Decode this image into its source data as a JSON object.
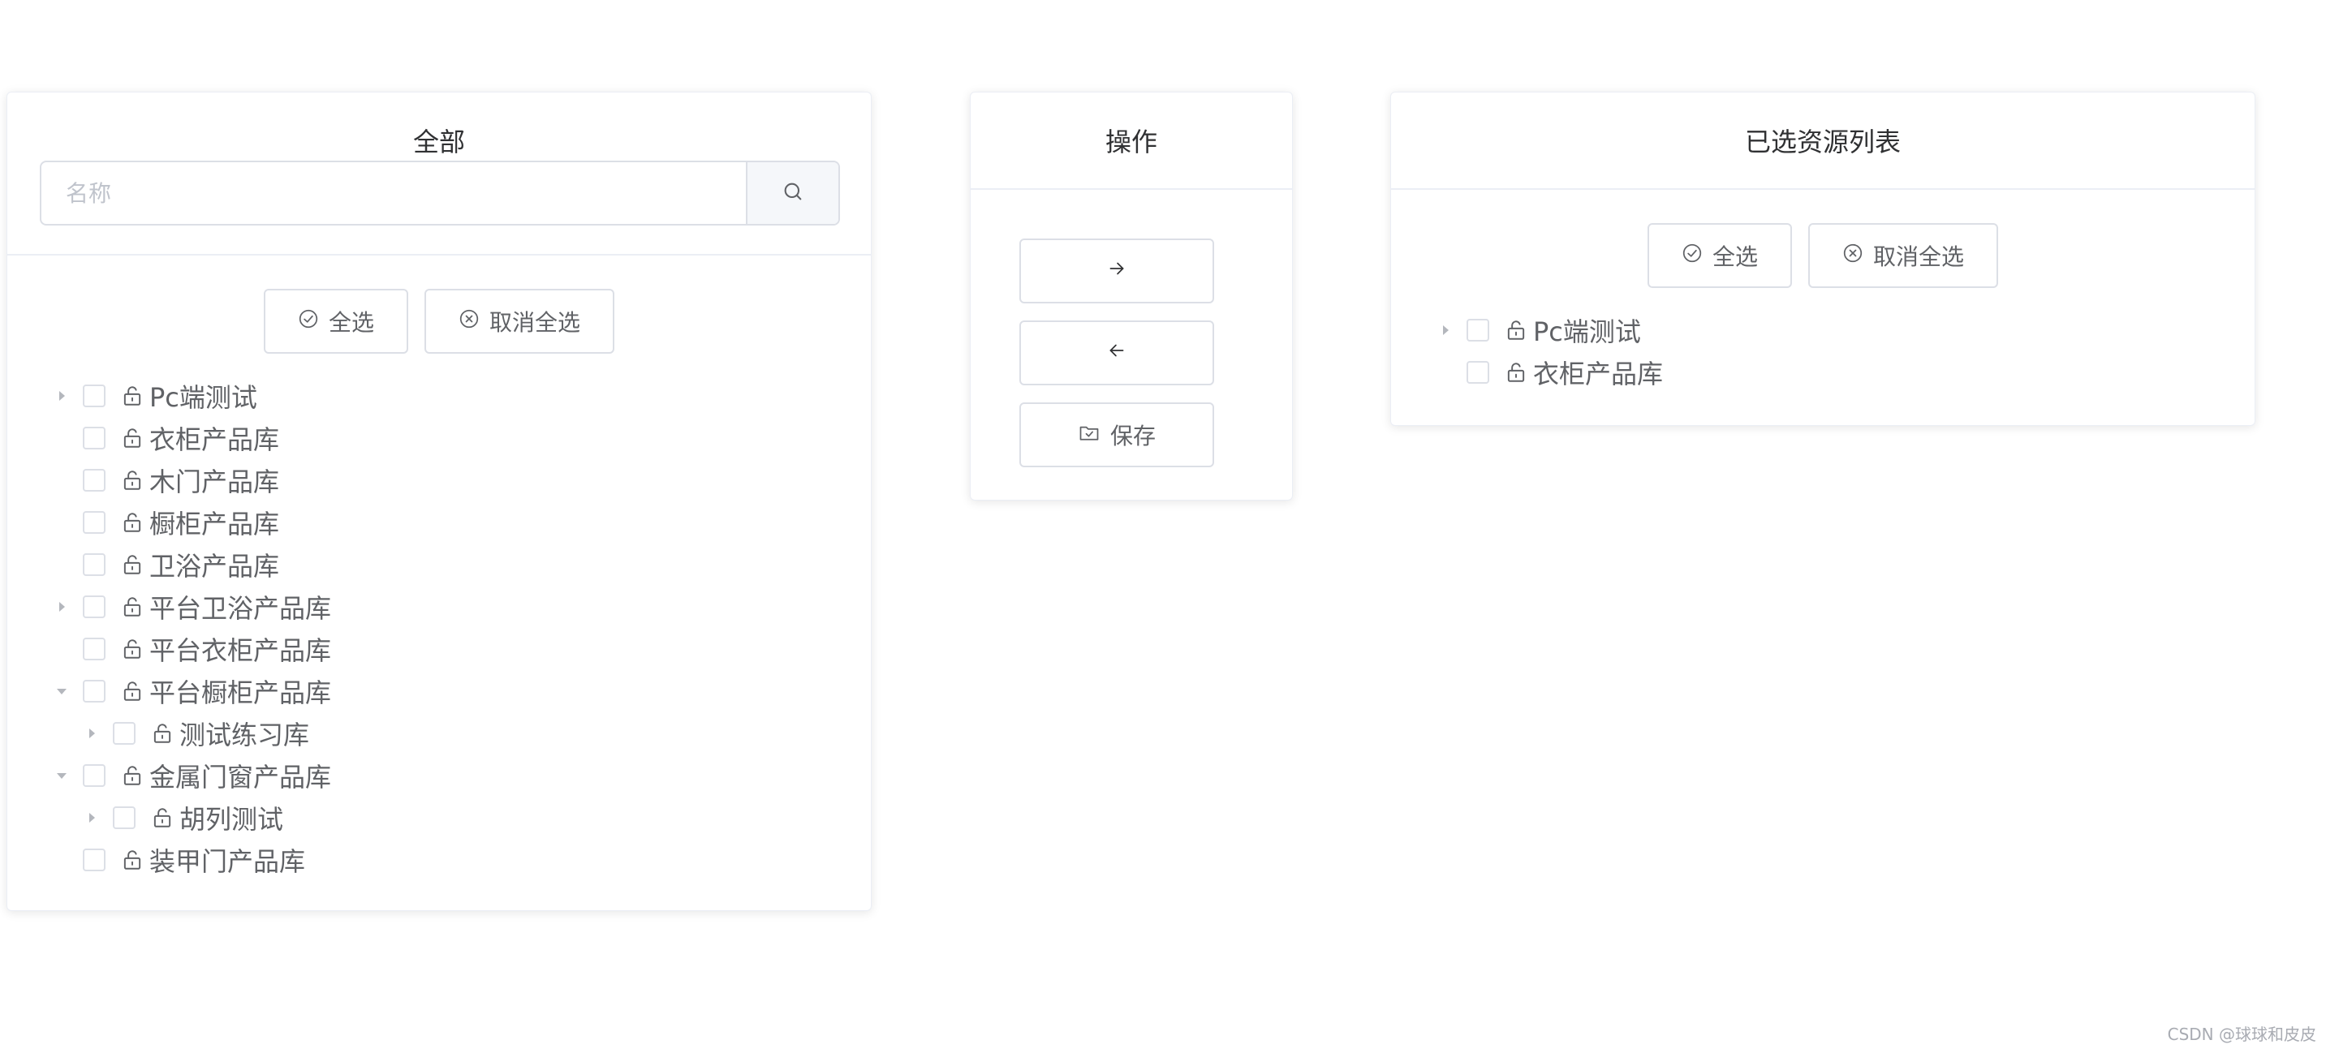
{
  "left_panel": {
    "title": "全部",
    "search": {
      "placeholder": "名称",
      "value": "",
      "icon": "search-icon"
    },
    "select_all_label": "全选",
    "deselect_all_label": "取消全选",
    "tree": [
      {
        "label": "Pc端测试",
        "level": 0,
        "caret": "collapsed"
      },
      {
        "label": "衣柜产品库",
        "level": 0,
        "caret": "none"
      },
      {
        "label": "木门产品库",
        "level": 0,
        "caret": "none"
      },
      {
        "label": "橱柜产品库",
        "level": 0,
        "caret": "none"
      },
      {
        "label": "卫浴产品库",
        "level": 0,
        "caret": "none"
      },
      {
        "label": "平台卫浴产品库",
        "level": 0,
        "caret": "collapsed"
      },
      {
        "label": "平台衣柜产品库",
        "level": 0,
        "caret": "none"
      },
      {
        "label": "平台橱柜产品库",
        "level": 0,
        "caret": "expanded"
      },
      {
        "label": "测试练习库",
        "level": 1,
        "caret": "collapsed"
      },
      {
        "label": "金属门窗产品库",
        "level": 0,
        "caret": "expanded"
      },
      {
        "label": "胡列测试",
        "level": 1,
        "caret": "collapsed"
      },
      {
        "label": "装甲门产品库",
        "level": 0,
        "caret": "none"
      }
    ]
  },
  "ops_panel": {
    "title": "操作",
    "move_right_icon": "arrow-right-icon",
    "move_left_icon": "arrow-left-icon",
    "save_label": "保存"
  },
  "right_panel": {
    "title": "已选资源列表",
    "select_all_label": "全选",
    "deselect_all_label": "取消全选",
    "tree": [
      {
        "label": "Pc端测试",
        "level": 0,
        "caret": "collapsed"
      },
      {
        "label": "衣柜产品库",
        "level": 0,
        "caret": "none"
      }
    ]
  },
  "watermark": "CSDN @球球和皮皮",
  "colors": {
    "border": "#dcdfe6",
    "text": "#606266",
    "title": "#303133",
    "placeholder": "#c0c4cc"
  }
}
